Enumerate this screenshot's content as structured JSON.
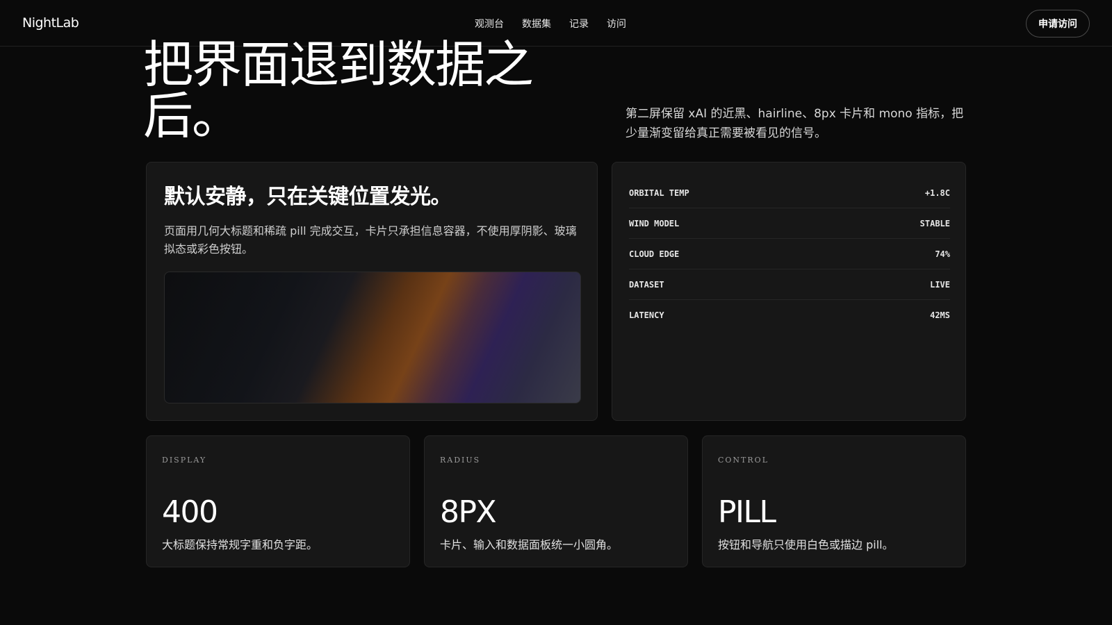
{
  "nav": {
    "brand": "NightLab",
    "links": [
      "观测台",
      "数据集",
      "记录",
      "访问"
    ],
    "cta": "申请访问"
  },
  "hero": {
    "title": "把界面退到数据之后。",
    "subtitle": "第二屏保留 xAI 的近黑、hairline、8px 卡片和 mono 指标，把少量渐变留给真正需要被看见的信号。"
  },
  "main_card": {
    "title": "默认安静，只在关键位置发光。",
    "body": "页面用几何大标题和稀疏 pill 完成交互，卡片只承担信息容器，不使用厚阴影、玻璃拟态或彩色按钮。"
  },
  "metrics": [
    {
      "label": "ORBITAL TEMP",
      "value": "+1.8C"
    },
    {
      "label": "WIND MODEL",
      "value": "STABLE"
    },
    {
      "label": "CLOUD EDGE",
      "value": "74%"
    },
    {
      "label": "DATASET",
      "value": "LIVE"
    },
    {
      "label": "LATENCY",
      "value": "42MS"
    }
  ],
  "features": [
    {
      "label": "DISPLAY",
      "value": "400",
      "desc": "大标题保持常规字重和负字距。"
    },
    {
      "label": "RADIUS",
      "value": "8PX",
      "desc": "卡片、输入和数据面板统一小圆角。"
    },
    {
      "label": "CONTROL",
      "value": "PILL",
      "desc": "按钮和导航只使用白色或描边 pill。"
    }
  ],
  "colors": {
    "background": "#0a0a0a",
    "card": "#171717",
    "border": "#262626",
    "gradient_orange": "#774218",
    "gradient_purple": "#2e2154"
  }
}
